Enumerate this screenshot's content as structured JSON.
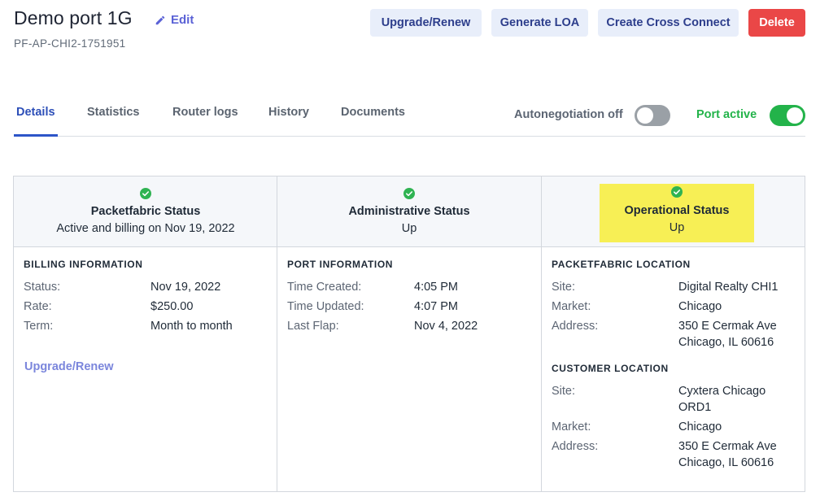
{
  "header": {
    "title": "Demo port 1G",
    "edit_label": "Edit",
    "subtitle": "PF-AP-CHI2-1751951"
  },
  "actions": {
    "upgrade": "Upgrade/Renew",
    "generate_loa": "Generate LOA",
    "cross_connect": "Create Cross Connect",
    "delete": "Delete"
  },
  "tabs": [
    {
      "label": "Details",
      "active": true
    },
    {
      "label": "Statistics"
    },
    {
      "label": "Router logs"
    },
    {
      "label": "History"
    },
    {
      "label": "Documents"
    }
  ],
  "toggles": {
    "autoneg_label": "Autonegotiation off",
    "autoneg_on": false,
    "port_active_label": "Port active",
    "port_active_on": true
  },
  "statuses": [
    {
      "title": "Packetfabric Status",
      "value": "Active and billing on Nov 19, 2022"
    },
    {
      "title": "Administrative Status",
      "value": "Up"
    },
    {
      "title": "Operational Status",
      "value": "Up",
      "highlighted": true
    }
  ],
  "billing": {
    "heading": "BILLING INFORMATION",
    "rows": [
      {
        "label": "Status:",
        "value": "Nov 19, 2022"
      },
      {
        "label": "Rate:",
        "value": "$250.00"
      },
      {
        "label": "Term:",
        "value": "Month to month"
      }
    ],
    "link": "Upgrade/Renew"
  },
  "port_info": {
    "heading": "PORT INFORMATION",
    "rows": [
      {
        "label": "Time Created:",
        "value": "4:05 PM"
      },
      {
        "label": "Time Updated:",
        "value": "4:07 PM"
      },
      {
        "label": "Last Flap:",
        "value": "Nov 4, 2022"
      }
    ]
  },
  "pf_location": {
    "heading": "PACKETFABRIC LOCATION",
    "site_label": "Site:",
    "site": "Digital Realty CHI1",
    "market_label": "Market:",
    "market": "Chicago",
    "address_label": "Address:",
    "address_line1": "350 E Cermak Ave",
    "address_line2": "Chicago, IL 60616"
  },
  "customer_location": {
    "heading": "CUSTOMER LOCATION",
    "site_label": "Site:",
    "site_line1": "Cyxtera Chicago",
    "site_line2": "ORD1",
    "market_label": "Market:",
    "market": "Chicago",
    "address_label": "Address:",
    "address_line1": "350 E Cermak Ave",
    "address_line2": "Chicago, IL 60616"
  },
  "colors": {
    "primary": "#2d55c8",
    "danger": "#ea4747",
    "success": "#23b34a",
    "highlight": "#f7ef55"
  }
}
